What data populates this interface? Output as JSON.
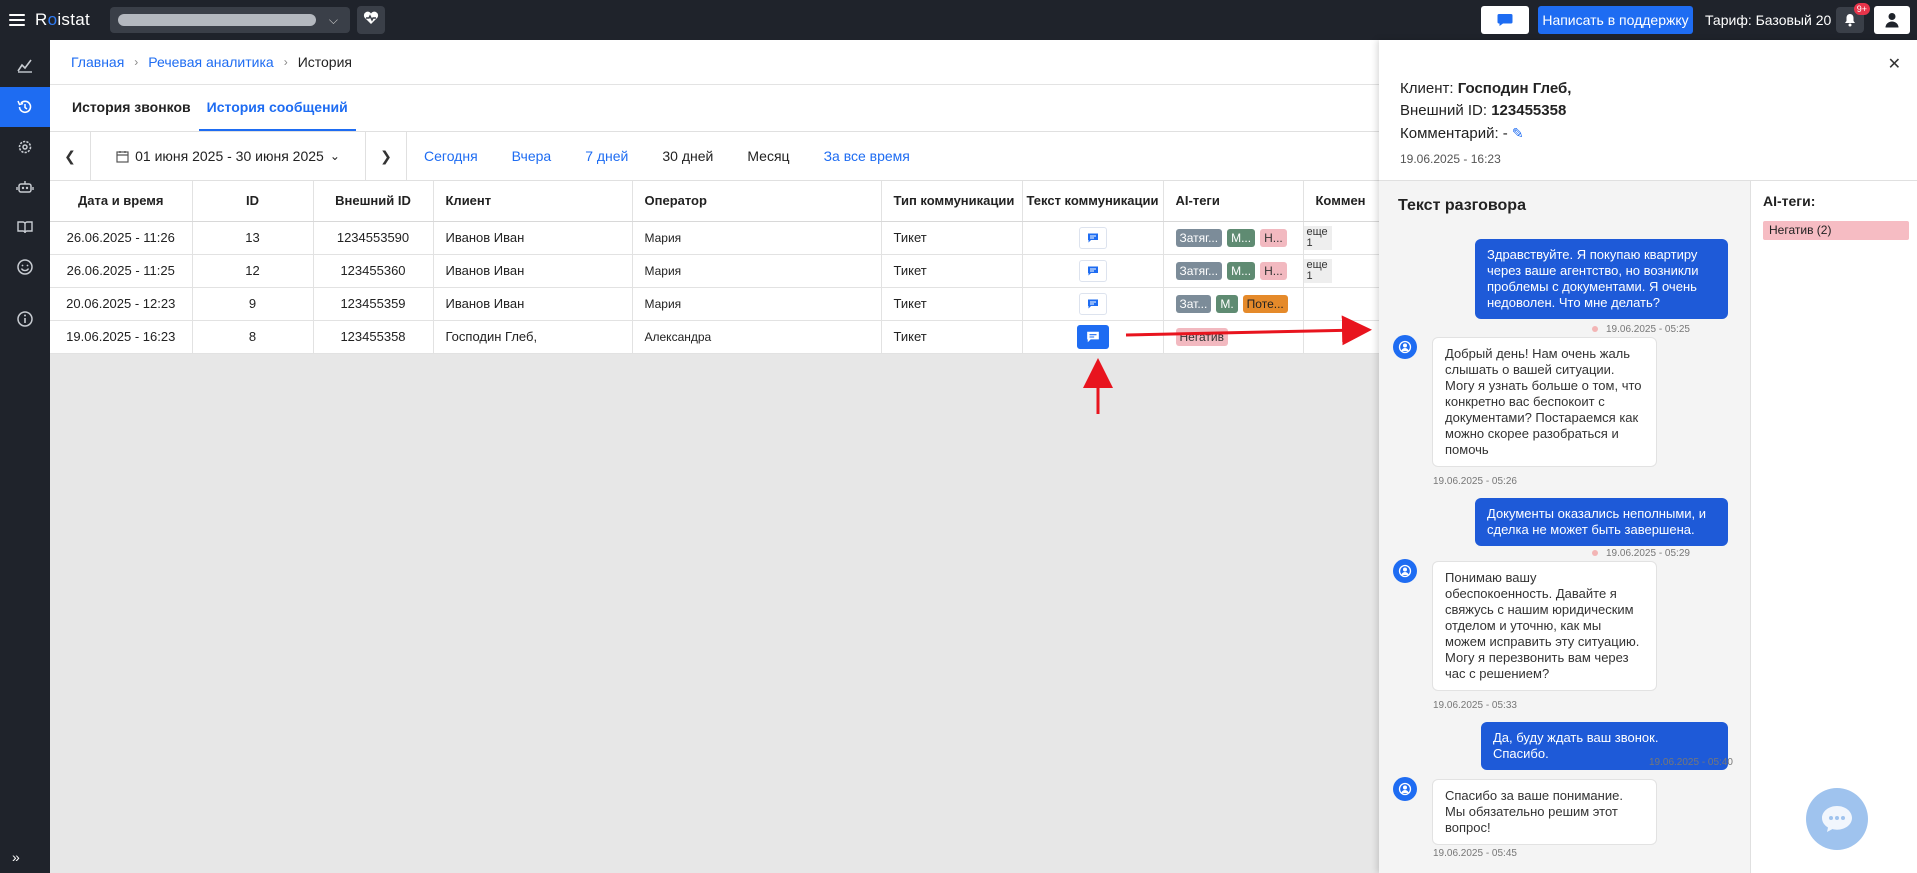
{
  "topbar": {
    "logo_pre": "R",
    "logo_accent": "o",
    "logo_post": "istat",
    "support_label": "Написать в поддержку",
    "tariff": "Тариф: Базовый 20",
    "notifications_badge": "9+"
  },
  "breadcrumb": [
    "Главная",
    "Речевая аналитика",
    "История"
  ],
  "tabs": [
    "История звонков",
    "История сообщений"
  ],
  "filters": {
    "date_range": "01 июня 2025 - 30 июня 2025",
    "periods": [
      "Сегодня",
      "Вчера",
      "7 дней",
      "30 дней",
      "Месяц",
      "За все время"
    ]
  },
  "table": {
    "headers": [
      "Дата и время",
      "ID",
      "Внешний ID",
      "Клиент",
      "Оператор",
      "Тип коммуникации",
      "Текст коммуникации",
      "AI-теги",
      "Коммен"
    ],
    "rows": [
      {
        "datetime": "26.06.2025 - 11:26",
        "id": "13",
        "ext_id": "1234553590",
        "client": "Иванов Иван",
        "operator": "Мария",
        "type": "Тикет",
        "tags": [
          "Затяг...",
          "М...",
          "Н..."
        ],
        "more": "еще 1"
      },
      {
        "datetime": "26.06.2025 - 11:25",
        "id": "12",
        "ext_id": "123455360",
        "client": "Иванов Иван",
        "operator": "Мария",
        "type": "Тикет",
        "tags": [
          "Затяг...",
          "М...",
          "Н..."
        ],
        "more": "еще 1"
      },
      {
        "datetime": "20.06.2025 - 12:23",
        "id": "9",
        "ext_id": "123455359",
        "client": "Иванов Иван",
        "operator": "Мария",
        "type": "Тикет",
        "tags": [
          "Зат...",
          "М.",
          "Поте..."
        ],
        "more": ""
      },
      {
        "datetime": "19.06.2025 - 16:23",
        "id": "8",
        "ext_id": "123455358",
        "client": "Господин Глеб,",
        "operator": "Александра",
        "type": "Тикет",
        "tags": [
          "Негатив"
        ],
        "more": ""
      }
    ]
  },
  "panel": {
    "client_label": "Клиент:",
    "client_value": "Господин Глеб,",
    "ext_label": "Внешний ID:",
    "ext_value": "123455358",
    "comment_label": "Комментарий: -",
    "timestamp": "19.06.2025 - 16:23",
    "conv_title": "Текст разговора",
    "aitags_title": "AI-теги:",
    "aitag": "Негатив (2)",
    "messages": [
      {
        "dir": "out",
        "text": "Здравствуйте. Я покупаю квартиру через ваше агентство, но возникли проблемы с документами. Я очень недоволен. Что мне делать?",
        "time": "19.06.2025 - 05:25"
      },
      {
        "dir": "in",
        "text": "Добрый день! Нам очень жаль слышать о вашей ситуации. Могу я узнать больше о том, что конкретно вас беспокоит с документами? Постараемся как можно скорее разобраться и помочь",
        "time": "19.06.2025 - 05:26"
      },
      {
        "dir": "out",
        "text": "Документы оказались неполными, и сделка не может быть завершена.",
        "time": "19.06.2025 - 05:29"
      },
      {
        "dir": "in",
        "text": "Понимаю вашу обеспокоенность. Давайте я свяжусь с нашим юридическим отделом и уточню, как мы можем исправить эту ситуацию. Могу я перезвонить вам через час с решением?",
        "time": "19.06.2025 - 05:33"
      },
      {
        "dir": "out",
        "text": "Да, буду ждать ваш звонок. Спасибо.",
        "time": "19.06.2025 - 05:40"
      },
      {
        "dir": "in",
        "text": "Спасибо за ваше понимание. Мы обязательно решим этот вопрос!",
        "time": "19.06.2025 - 05:45"
      }
    ]
  },
  "icons": {
    "menu": "menu-icon",
    "heart_monitor": "heart-pulse-icon",
    "chat": "chat-icon",
    "bell": "bell-icon",
    "user": "user-icon",
    "close": "close-icon",
    "edit": "pencil-icon"
  },
  "colors": {
    "accent": "#1e6cf2",
    "topbar": "#1f232b",
    "outgoing_bubble": "#1e5ad8",
    "negative_tag": "#f6bcc3",
    "annotation_arrow": "#e8141e"
  }
}
